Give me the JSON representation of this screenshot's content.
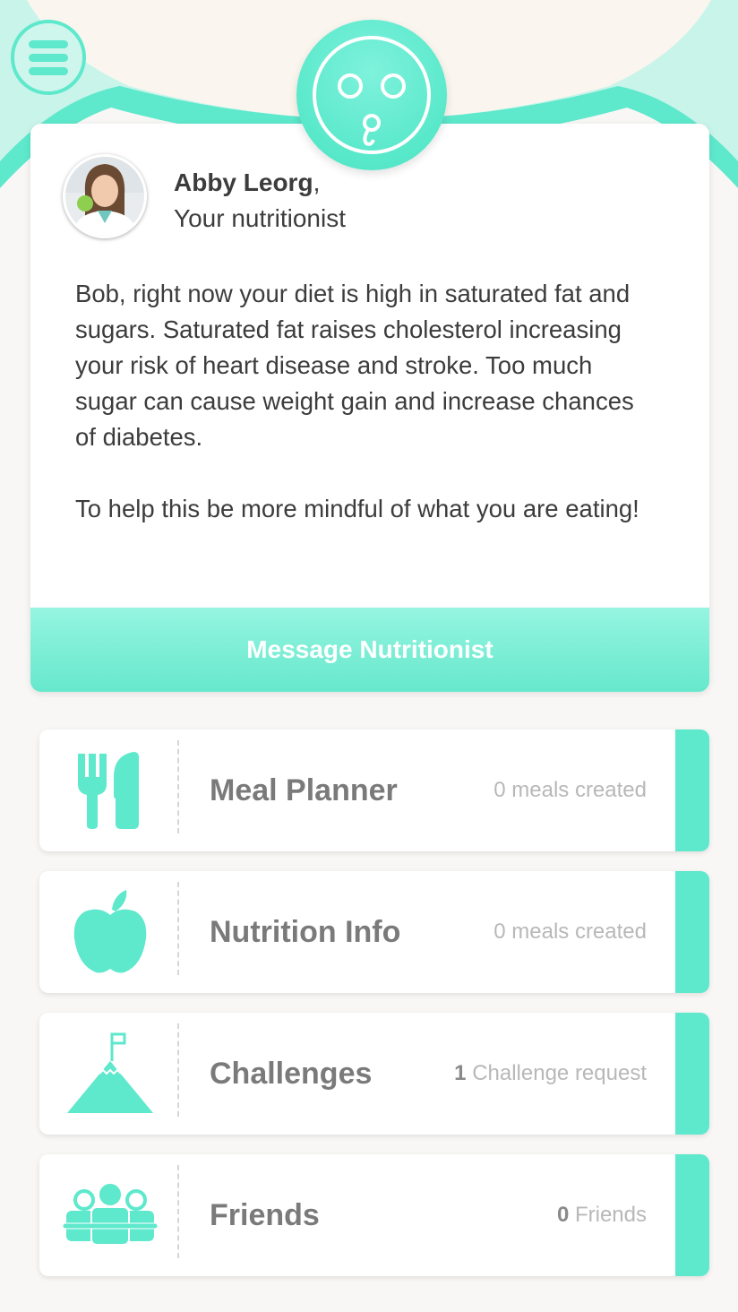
{
  "header": {
    "menu_icon": "hamburger-menu-icon",
    "logo_icon": "surprised-face-logo-icon"
  },
  "nutritionist": {
    "name": "Abby Leorg",
    "name_suffix": ",",
    "role": "Your nutritionist",
    "avatar": "nutritionist-photo",
    "message_paragraphs": [
      "Bob, right now your diet is high in saturated fat and sugars. Saturated fat raises cholesterol increasing your risk of heart disease and stroke. Too much sugar can cause weight gain and increase chances of diabetes.",
      "To help this be more mindful of what you are eating!"
    ],
    "button_label": "Message Nutritionist"
  },
  "tiles": [
    {
      "label": "Meal Planner",
      "count": "",
      "meta": "0 meals created",
      "icon": "fork-knife-icon"
    },
    {
      "label": "Nutrition Info",
      "count": "",
      "meta": "0 meals created",
      "icon": "apple-icon"
    },
    {
      "label": "Challenges",
      "count": "1",
      "meta": "Challenge request",
      "icon": "mountain-flag-icon"
    },
    {
      "label": "Friends",
      "count": "0",
      "meta": "Friends",
      "icon": "friends-group-icon"
    }
  ],
  "colors": {
    "accent": "#5ee8cc",
    "background": "#f8f7f5",
    "arc_light": "#faf6ef"
  }
}
